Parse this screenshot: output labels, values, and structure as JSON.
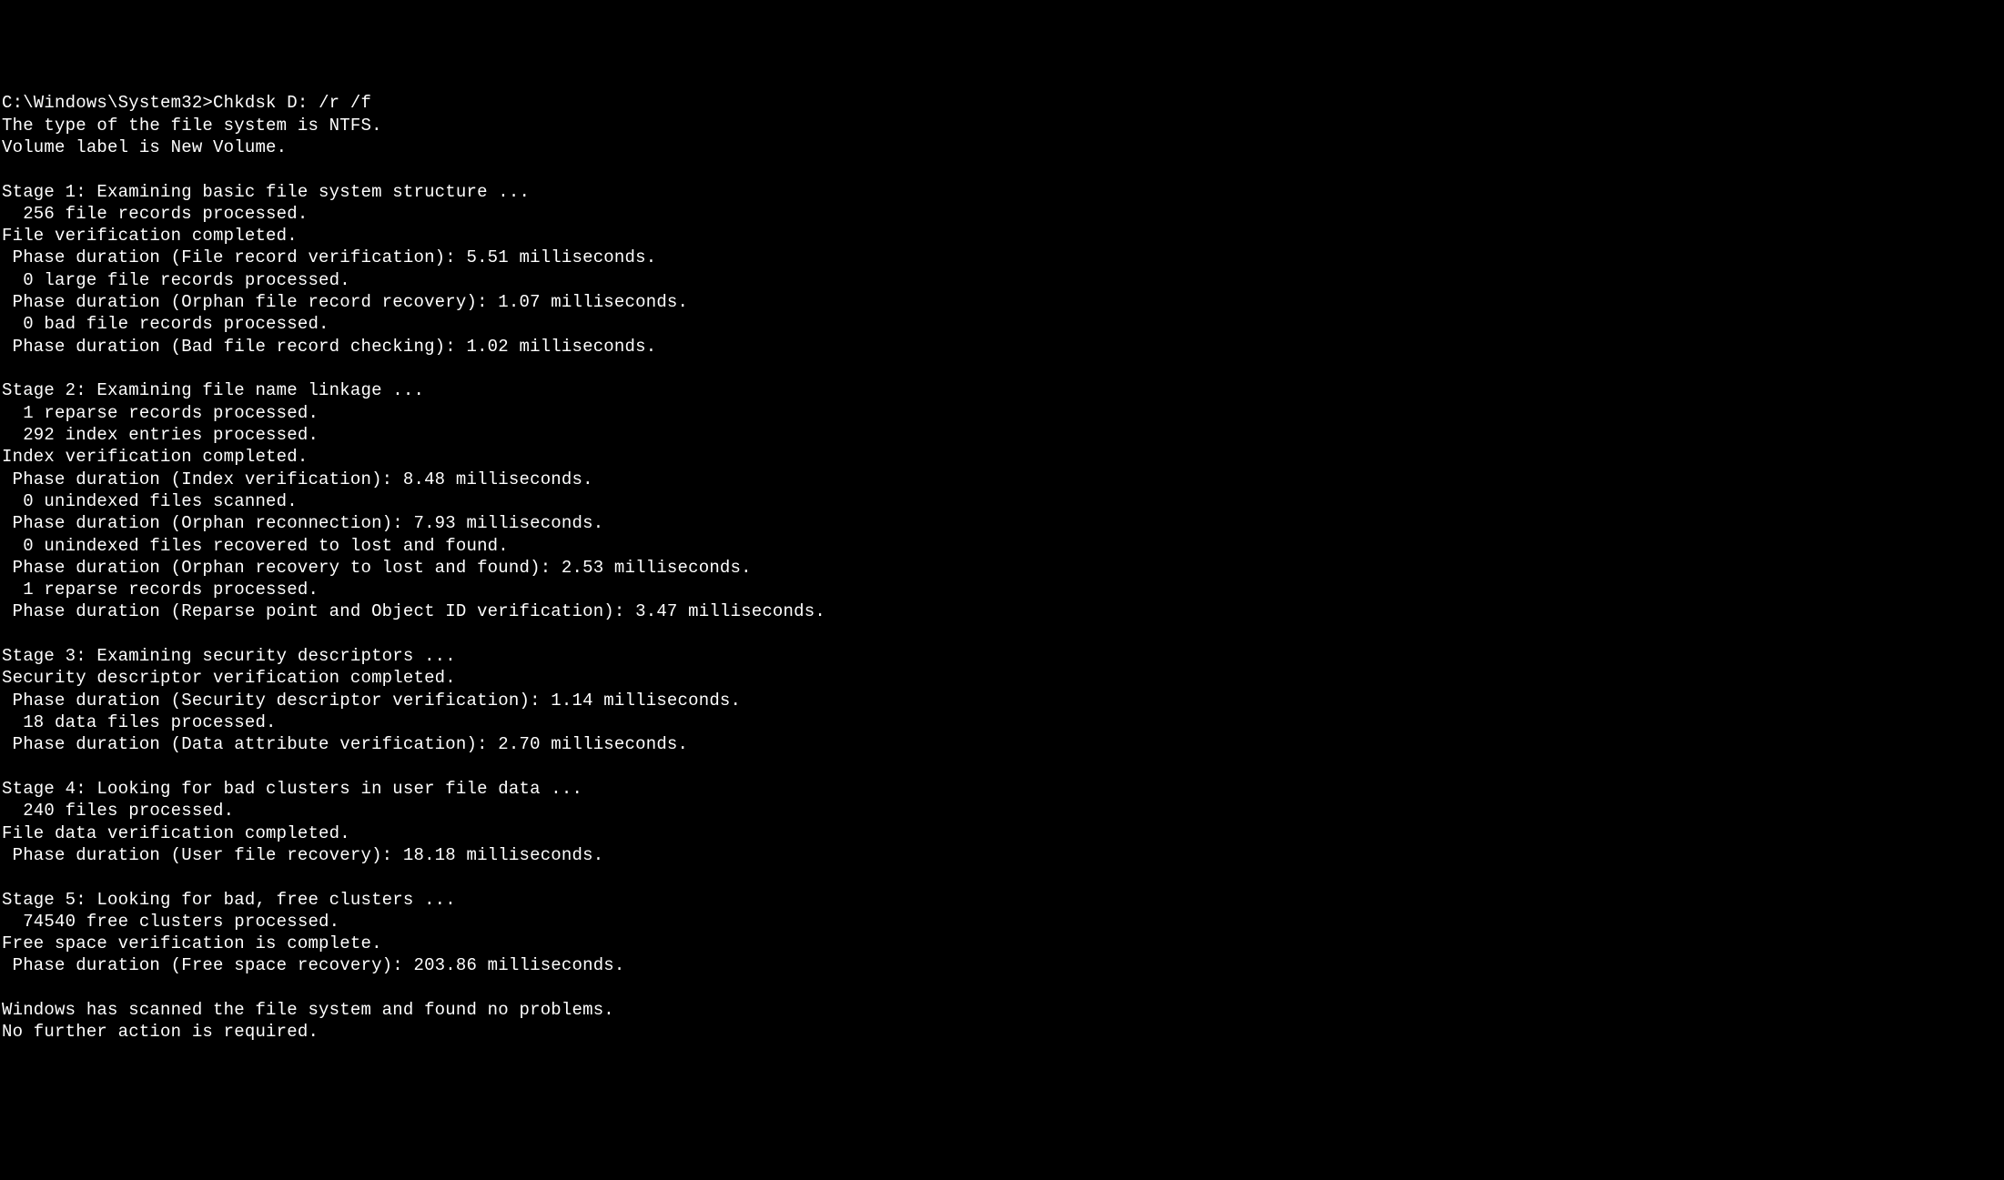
{
  "prompt": "C:\\Windows\\System32>",
  "command": "Chkdsk D: /r /f",
  "lines": [
    "The type of the file system is NTFS.",
    "Volume label is New Volume.",
    "",
    "Stage 1: Examining basic file system structure ...",
    "  256 file records processed.",
    "File verification completed.",
    " Phase duration (File record verification): 5.51 milliseconds.",
    "  0 large file records processed.",
    " Phase duration (Orphan file record recovery): 1.07 milliseconds.",
    "  0 bad file records processed.",
    " Phase duration (Bad file record checking): 1.02 milliseconds.",
    "",
    "Stage 2: Examining file name linkage ...",
    "  1 reparse records processed.",
    "  292 index entries processed.",
    "Index verification completed.",
    " Phase duration (Index verification): 8.48 milliseconds.",
    "  0 unindexed files scanned.",
    " Phase duration (Orphan reconnection): 7.93 milliseconds.",
    "  0 unindexed files recovered to lost and found.",
    " Phase duration (Orphan recovery to lost and found): 2.53 milliseconds.",
    "  1 reparse records processed.",
    " Phase duration (Reparse point and Object ID verification): 3.47 milliseconds.",
    "",
    "Stage 3: Examining security descriptors ...",
    "Security descriptor verification completed.",
    " Phase duration (Security descriptor verification): 1.14 milliseconds.",
    "  18 data files processed.",
    " Phase duration (Data attribute verification): 2.70 milliseconds.",
    "",
    "Stage 4: Looking for bad clusters in user file data ...",
    "  240 files processed.",
    "File data verification completed.",
    " Phase duration (User file recovery): 18.18 milliseconds.",
    "",
    "Stage 5: Looking for bad, free clusters ...",
    "  74540 free clusters processed.",
    "Free space verification is complete.",
    " Phase duration (Free space recovery): 203.86 milliseconds.",
    "",
    "Windows has scanned the file system and found no problems.",
    "No further action is required."
  ]
}
